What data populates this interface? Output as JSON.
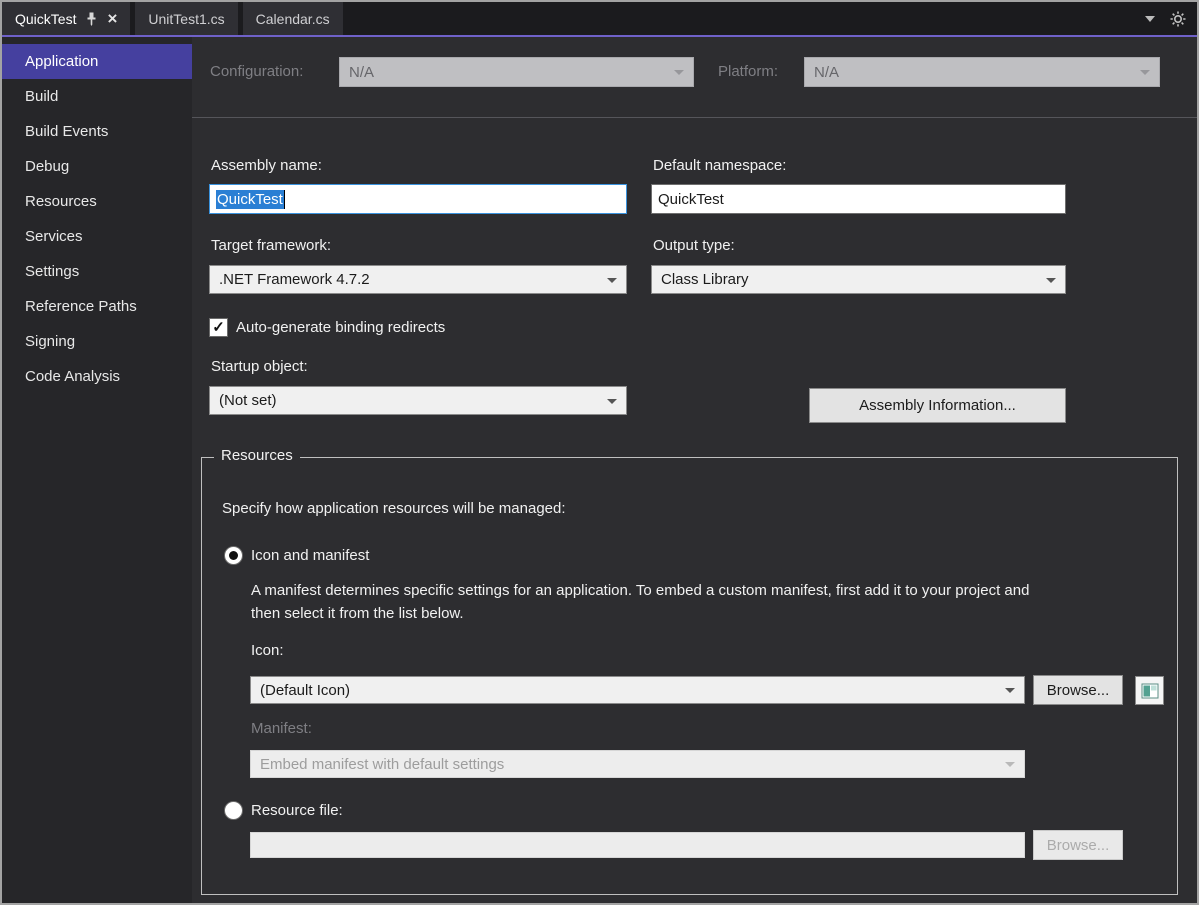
{
  "colors": {
    "accent": "#6f61c9",
    "sidebar_selection": "#45409f",
    "selection": "#2a7fd4"
  },
  "icons": {
    "check_glyph": "✓",
    "close_glyph": "×"
  },
  "tabs": {
    "items": [
      {
        "label": "QuickTest",
        "active": true
      },
      {
        "label": "UnitTest1.cs",
        "active": false
      },
      {
        "label": "Calendar.cs",
        "active": false
      }
    ]
  },
  "sidebar": {
    "items": [
      "Application",
      "Build",
      "Build Events",
      "Debug",
      "Resources",
      "Services",
      "Settings",
      "Reference Paths",
      "Signing",
      "Code Analysis"
    ]
  },
  "header": {
    "configuration_label": "Configuration:",
    "configuration_value": "N/A",
    "platform_label": "Platform:",
    "platform_value": "N/A"
  },
  "form": {
    "assembly_name_label": "Assembly name:",
    "assembly_name_value": "QuickTest",
    "default_namespace_label": "Default namespace:",
    "default_namespace_value": "QuickTest",
    "target_framework_label": "Target framework:",
    "target_framework_value": ".NET Framework 4.7.2",
    "output_type_label": "Output type:",
    "output_type_value": "Class Library",
    "auto_generate_label": "Auto-generate binding redirects",
    "auto_generate_checked": true,
    "startup_object_label": "Startup object:",
    "startup_object_value": "(Not set)",
    "assembly_information_button": "Assembly Information..."
  },
  "resources": {
    "group_title": "Resources",
    "description": "Specify how application resources will be managed:",
    "icon_and_manifest_label": "Icon and manifest",
    "icon_and_manifest_selected": true,
    "manifest_help": "A manifest determines specific settings for an application. To embed a custom manifest, first add it to your project and then select it from the list below.",
    "icon_label": "Icon:",
    "icon_value": "(Default Icon)",
    "browse_button": "Browse...",
    "manifest_label": "Manifest:",
    "manifest_value": "Embed manifest with default settings",
    "resource_file_label": "Resource file:",
    "resource_file_value": "",
    "resource_file_selected": false,
    "resource_browse_button": "Browse..."
  }
}
